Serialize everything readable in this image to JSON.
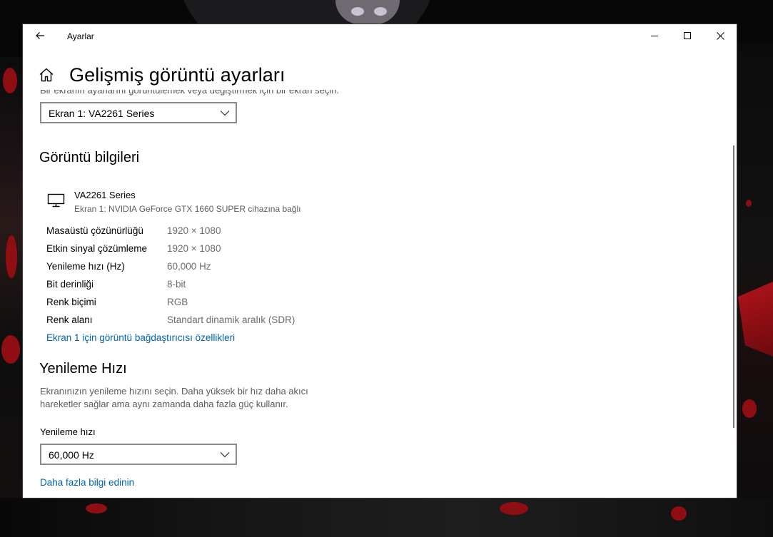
{
  "window": {
    "app_title": "Ayarlar",
    "page_title": "Gelişmiş görüntü ayarları"
  },
  "top": {
    "cut_text": "Bir ekranın ayarlarını görüntülemek veya değiştirmek için bir ekran seçin.",
    "display_select": {
      "value": "Ekran 1: VA2261 Series"
    }
  },
  "display_info": {
    "heading": "Görüntü bilgileri",
    "monitor_name": "VA2261 Series",
    "monitor_sub": "Ekran 1: NVIDIA GeForce GTX 1660 SUPER cihazına bağlı",
    "rows": [
      {
        "label": "Masaüstü çözünürlüğü",
        "value": "1920 × 1080"
      },
      {
        "label": "Etkin sinyal çözümleme",
        "value": "1920 × 1080"
      },
      {
        "label": "Yenileme hızı (Hz)",
        "value": "60,000 Hz"
      },
      {
        "label": "Bit derinliği",
        "value": "8-bit"
      },
      {
        "label": "Renk biçimi",
        "value": "RGB"
      },
      {
        "label": "Renk alanı",
        "value": "Standart dinamik aralık (SDR)"
      }
    ],
    "adapter_link": "Ekran 1 için görüntü bağdaştırıcısı özellikleri"
  },
  "refresh": {
    "heading": "Yenileme Hızı",
    "desc_line1": "Ekranınızın yenileme hızını seçin. Daha yüksek bir hız daha akıcı",
    "desc_line2": "hareketler sağlar ama aynı zamanda daha fazla güç kullanır.",
    "field_label": "Yenileme hızı",
    "select_value": "60,000 Hz",
    "more_link": "Daha fazla bilgi edinin"
  },
  "icons": {
    "back": "back-arrow-icon",
    "minimize": "minimize-icon",
    "maximize": "maximize-icon",
    "close": "close-icon",
    "home": "home-icon",
    "monitor": "monitor-icon",
    "dropdown": "chevron-down-icon"
  },
  "colors": {
    "link": "#0063b1",
    "secondary_text": "#6b6b6b"
  }
}
